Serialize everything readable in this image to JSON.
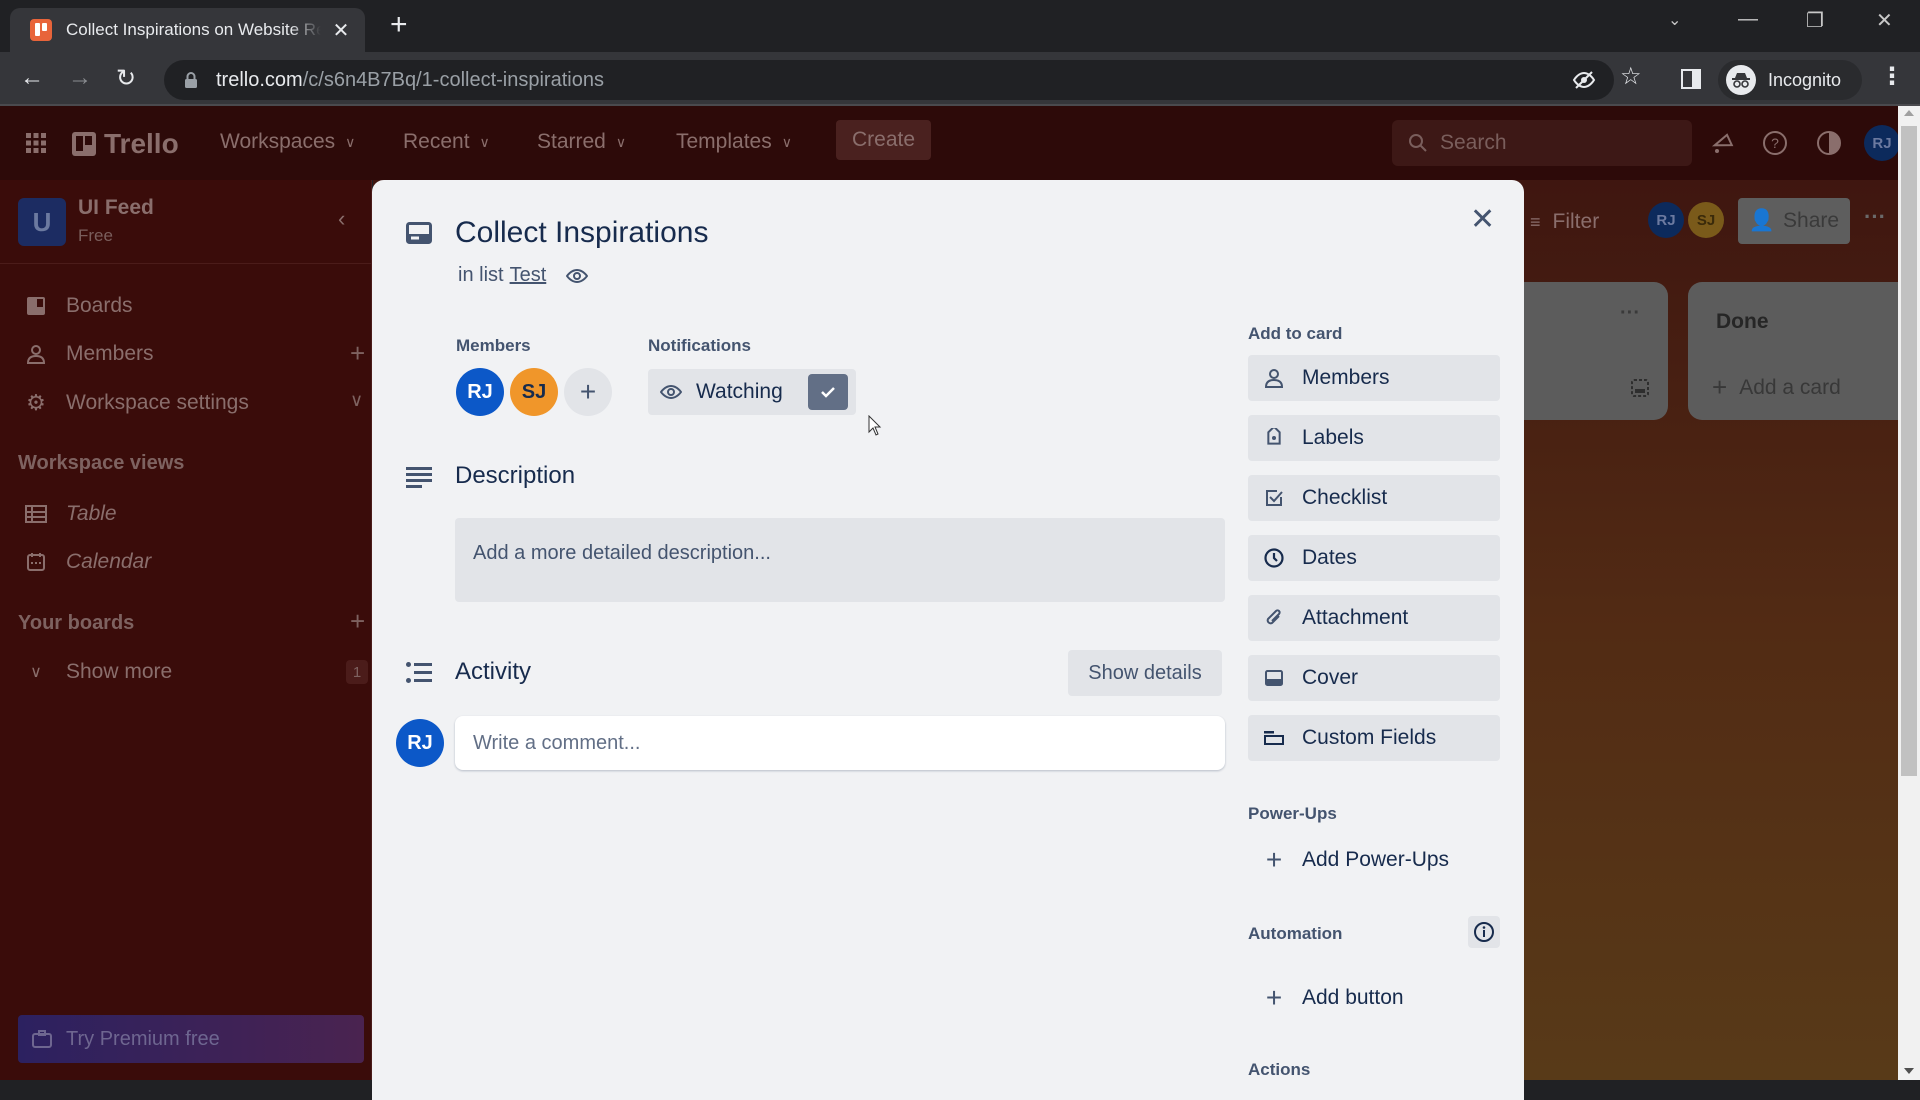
{
  "browser": {
    "tab_title": "Collect Inspirations on Website Redesign | Trello",
    "url_host": "trello.com",
    "url_path": "/c/s6n4B7Bq/1-collect-inspirations",
    "profile_label": "Incognito"
  },
  "header": {
    "logo": "Trello",
    "nav": [
      {
        "label": "Workspaces"
      },
      {
        "label": "Recent"
      },
      {
        "label": "Starred"
      },
      {
        "label": "Templates"
      }
    ],
    "create_label": "Create",
    "search_placeholder": "Search",
    "user_initials": "RJ"
  },
  "sidebar": {
    "workspace_initial": "U",
    "workspace_name": "UI Feed",
    "workspace_plan": "Free",
    "items": [
      {
        "label": "Boards",
        "icon": "board-icon"
      },
      {
        "label": "Members",
        "icon": "person-icon"
      },
      {
        "label": "Workspace settings",
        "icon": "gear-icon"
      }
    ],
    "views_heading": "Workspace views",
    "views": [
      {
        "label": "Table",
        "icon": "table-icon"
      },
      {
        "label": "Calendar",
        "icon": "calendar-icon"
      }
    ],
    "boards_heading": "Your boards",
    "show_more_label": "Show more",
    "show_more_count": "1",
    "premium_label": "Try Premium free"
  },
  "board": {
    "filter_label": "Filter",
    "members": [
      "RJ",
      "SJ"
    ],
    "share_label": "Share",
    "lists": [
      {
        "title": ""
      },
      {
        "title": "Done",
        "add_card_label": "Add a card"
      }
    ]
  },
  "card": {
    "title": "Collect Inspirations",
    "in_list_prefix": "in list",
    "list_name": "Test",
    "members_label": "Members",
    "members": [
      {
        "initials": "RJ",
        "color": "#0c58c8"
      },
      {
        "initials": "SJ",
        "color": "#f0962a"
      }
    ],
    "notifications_label": "Notifications",
    "watching_label": "Watching",
    "watching": true,
    "description_title": "Description",
    "description_placeholder": "Add a more detailed description...",
    "activity_title": "Activity",
    "show_details_label": "Show details",
    "comment_avatar": "RJ",
    "comment_placeholder": "Write a comment..."
  },
  "card_sidebar": {
    "add_to_card_heading": "Add to card",
    "add_to_card": [
      {
        "label": "Members",
        "icon": "person-icon"
      },
      {
        "label": "Labels",
        "icon": "label-icon"
      },
      {
        "label": "Checklist",
        "icon": "checklist-icon"
      },
      {
        "label": "Dates",
        "icon": "clock-icon"
      },
      {
        "label": "Attachment",
        "icon": "paperclip-icon"
      },
      {
        "label": "Cover",
        "icon": "cover-icon"
      },
      {
        "label": "Custom Fields",
        "icon": "custom-fields-icon"
      }
    ],
    "powerups_heading": "Power-Ups",
    "add_powerups_label": "Add Power-Ups",
    "automation_heading": "Automation",
    "add_button_label": "Add button",
    "actions_heading": "Actions"
  }
}
